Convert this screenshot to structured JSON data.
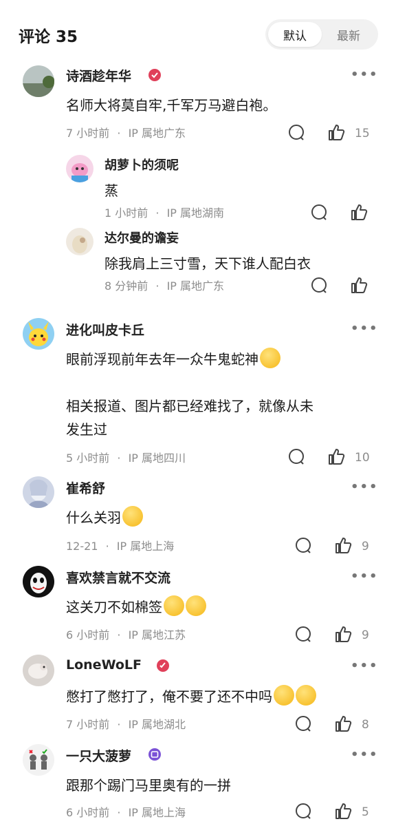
{
  "header": {
    "title": "评论 35",
    "sort_default": "默认",
    "sort_latest": "最新"
  },
  "comments": [
    {
      "user": "诗酒趁年华",
      "text": "名师大将莫自牢,千军万马避白袍。",
      "time": "7 小时前",
      "location": "IP 属地广东",
      "likes": "15",
      "replies": [
        {
          "user": "胡萝卜的须呢",
          "text": "蒸",
          "time": "1 小时前",
          "location": "IP 属地湖南"
        },
        {
          "user": "达尔曼的谵妄",
          "text": "除我肩上三寸雪，天下谁人配白衣",
          "time": "8 分钟前",
          "location": "IP 属地广东"
        }
      ]
    },
    {
      "user": "进化叫皮卡丘",
      "text_line1": "眼前浮现前年去年一众牛鬼蛇神",
      "text_line2": "相关报道、图片都已经难找了，就像从未",
      "text_line3": "发生过",
      "time": "5 小时前",
      "location": "IP 属地四川",
      "likes": "10"
    },
    {
      "user": "崔希舒",
      "text": "什么关羽",
      "time": "12-21",
      "location": "IP 属地上海",
      "likes": "9"
    },
    {
      "user": "喜欢禁言就不交流",
      "text": "这关刀不如棉签",
      "time": "6 小时前",
      "location": "IP 属地江苏",
      "likes": "9"
    },
    {
      "user": "LoneWoLF",
      "text": "憋打了憋打了，俺不要了还不中吗",
      "time": "7 小时前",
      "location": "IP 属地湖北",
      "likes": "8"
    },
    {
      "user": "一只大菠萝",
      "text": "跟那个踢门马里奥有的一拼",
      "time": "6 小时前",
      "location": "IP 属地上海",
      "likes": "5"
    }
  ],
  "meta_separator": "·",
  "more_label": "•••",
  "colors": {
    "badge_red": "#e0405a",
    "badge_purple": "#7b52d6",
    "text_muted": "#8c8c8c"
  }
}
